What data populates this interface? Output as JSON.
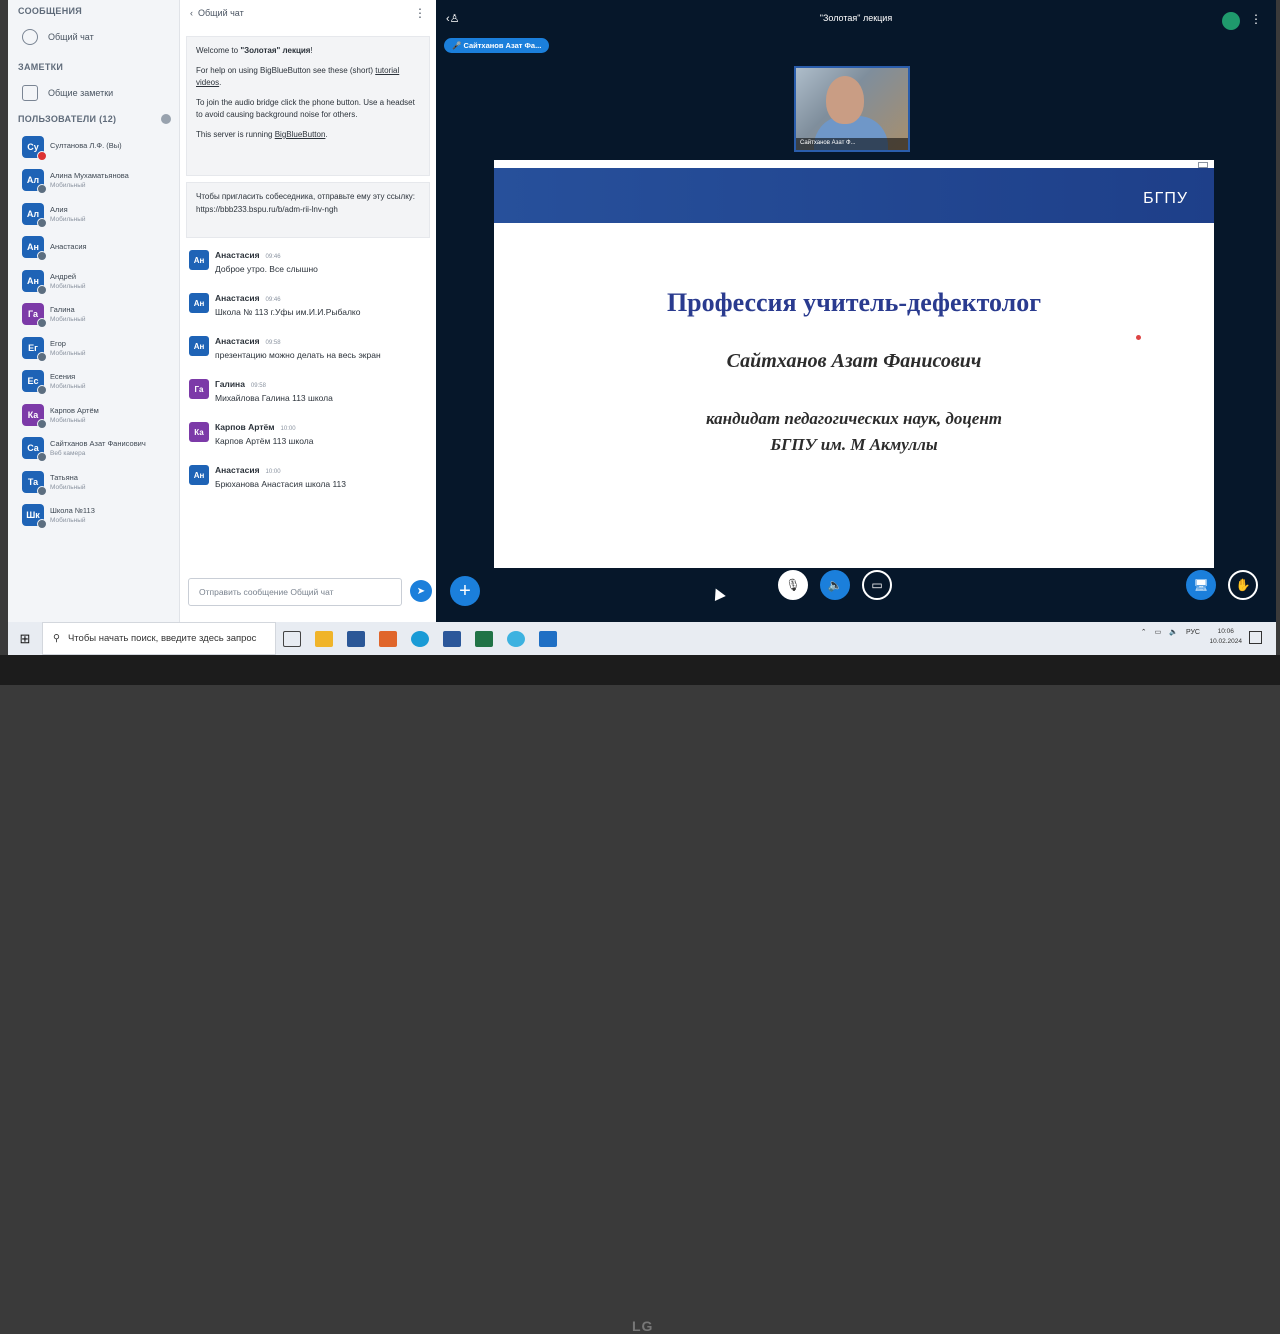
{
  "left": {
    "messages_title": "СООБЩЕНИЯ",
    "public_chat": "Общий чат",
    "notes_title": "ЗАМЕТКИ",
    "shared_notes": "Общие заметки",
    "users_title": "ПОЛЬЗОВАТЕЛИ (12)",
    "users": [
      {
        "initials": "Су",
        "name": "Султанова Л.Ф. (Вы)",
        "sub": "",
        "color": "#1e63b6"
      },
      {
        "initials": "Ал",
        "name": "Алина Мухаматьянова",
        "sub": "Мобильный",
        "color": "#1e63b6"
      },
      {
        "initials": "Ал",
        "name": "Алия",
        "sub": "Мобильный",
        "color": "#1e63b6"
      },
      {
        "initials": "Ан",
        "name": "Анастасия",
        "sub": "",
        "color": "#1e63b6"
      },
      {
        "initials": "Ан",
        "name": "Андрей",
        "sub": "Мобильный",
        "color": "#1e63b6"
      },
      {
        "initials": "Га",
        "name": "Галина",
        "sub": "Мобильный",
        "color": "#7c3aa8"
      },
      {
        "initials": "Ег",
        "name": "Егор",
        "sub": "Мобильный",
        "color": "#1e63b6"
      },
      {
        "initials": "Ес",
        "name": "Есения",
        "sub": "Мобильный",
        "color": "#1e63b6"
      },
      {
        "initials": "Ка",
        "name": "Карпов Артём",
        "sub": "Мобильный",
        "color": "#7c3aa8"
      },
      {
        "initials": "Са",
        "name": "Сайтханов Азат Фанисович",
        "sub": "Веб камера",
        "color": "#1e63b6"
      },
      {
        "initials": "Та",
        "name": "Татьяна",
        "sub": "Мобильный",
        "color": "#1e63b6"
      },
      {
        "initials": "Шк",
        "name": "Школа №113",
        "sub": "Мобильный",
        "color": "#1e63b6"
      }
    ]
  },
  "chat": {
    "back_label": "Общий чат",
    "welcome_title_prefix": "Welcome to ",
    "welcome_title_name": "\"Золотая\" лекция",
    "welcome_title_suffix": "!",
    "help_prefix": "For help on using BigBlueButton see these (short) ",
    "help_link": "tutorial videos",
    "help_suffix": ".",
    "audio_text": "To join the audio bridge click the phone button. Use a headset to avoid causing background noise for others.",
    "server_prefix": "This server is running ",
    "server_link": "BigBlueButton",
    "server_suffix": ".",
    "invite_text": "Чтобы пригласить собеседника, отправьте ему эту ссылку:",
    "invite_link": "https://bbb233.bspu.ru/b/adm-rii-lnv-ngh",
    "messages": [
      {
        "initials": "Ан",
        "name": "Анастасия",
        "time": "09:46",
        "text": "Доброе утро. Все слышно",
        "color": "#1e63b6"
      },
      {
        "initials": "Ан",
        "name": "Анастасия",
        "time": "09:46",
        "text": "Школа № 113 г.Уфы им.И.И.Рыбалко",
        "color": "#1e63b6"
      },
      {
        "initials": "Ан",
        "name": "Анастасия",
        "time": "09:58",
        "text": "презентацию можно делать на весь экран",
        "color": "#1e63b6"
      },
      {
        "initials": "Га",
        "name": "Галина",
        "time": "09:58",
        "text": "Михайлова Галина 113 школа",
        "color": "#7c3aa8"
      },
      {
        "initials": "Ка",
        "name": "Карпов Артём",
        "time": "10:00",
        "text": "Карпов Артём 113 школа",
        "color": "#7c3aa8"
      },
      {
        "initials": "Ан",
        "name": "Анастасия",
        "time": "10:00",
        "text": "Брюханова Анастасия школа 113",
        "color": "#1e63b6"
      }
    ],
    "input_placeholder": "Отправить сообщение Общий чат"
  },
  "main": {
    "title": "\"Золотая\" лекция",
    "talker": "Сайтханов Азат Фа...",
    "webcam_name": "Сайтханов Азат Ф...",
    "slide": {
      "logo": "БГПУ",
      "title": "Профессия учитель-дефектолог",
      "author": "Сайтханов Азат Фанисович",
      "degree_line1": "кандидат педагогических наук, доцент",
      "degree_line2": "БГПУ им. М Акмуллы"
    }
  },
  "taskbar": {
    "search_placeholder": "Чтобы начать поиск, введите здесь запрос",
    "lang": "РУС",
    "time": "10:06",
    "date": "10.02.2024"
  },
  "monitor": {
    "brand": "LG"
  }
}
